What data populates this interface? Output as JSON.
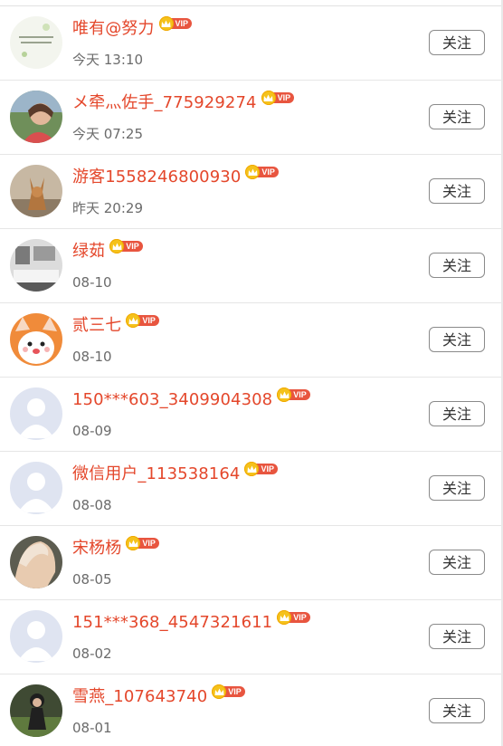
{
  "follow_label": "关注",
  "vip_label": "VIP",
  "colors": {
    "name": "#e4472b",
    "vip_badge": "#e8553f",
    "crown": "#f5c21b",
    "time": "#6b6b6b",
    "divider": "#e6e6e6"
  },
  "users": [
    {
      "name": "唯有@努力",
      "time": "今天 13:10",
      "avatar": "quote-card-avatar"
    },
    {
      "name": "メ牵灬佐手_775929274",
      "time": "今天 07:25",
      "avatar": "photo-avatar"
    },
    {
      "name": "游客1558246800930",
      "time": "昨天 20:29",
      "avatar": "dog-avatar"
    },
    {
      "name": "绿茹",
      "time": "08-10",
      "avatar": "room-avatar"
    },
    {
      "name": "贰三七",
      "time": "08-10",
      "avatar": "cartoon-avatar"
    },
    {
      "name": "150***603_3409904308",
      "time": "08-09",
      "avatar": "default-avatar"
    },
    {
      "name": "微信用户_113538164",
      "time": "08-08",
      "avatar": "default-avatar"
    },
    {
      "name": "宋杨杨",
      "time": "08-05",
      "avatar": "photo-avatar"
    },
    {
      "name": "151***368_4547321611",
      "time": "08-02",
      "avatar": "default-avatar"
    },
    {
      "name": "雪燕_107643740",
      "time": "08-01",
      "avatar": "photo-avatar"
    }
  ]
}
